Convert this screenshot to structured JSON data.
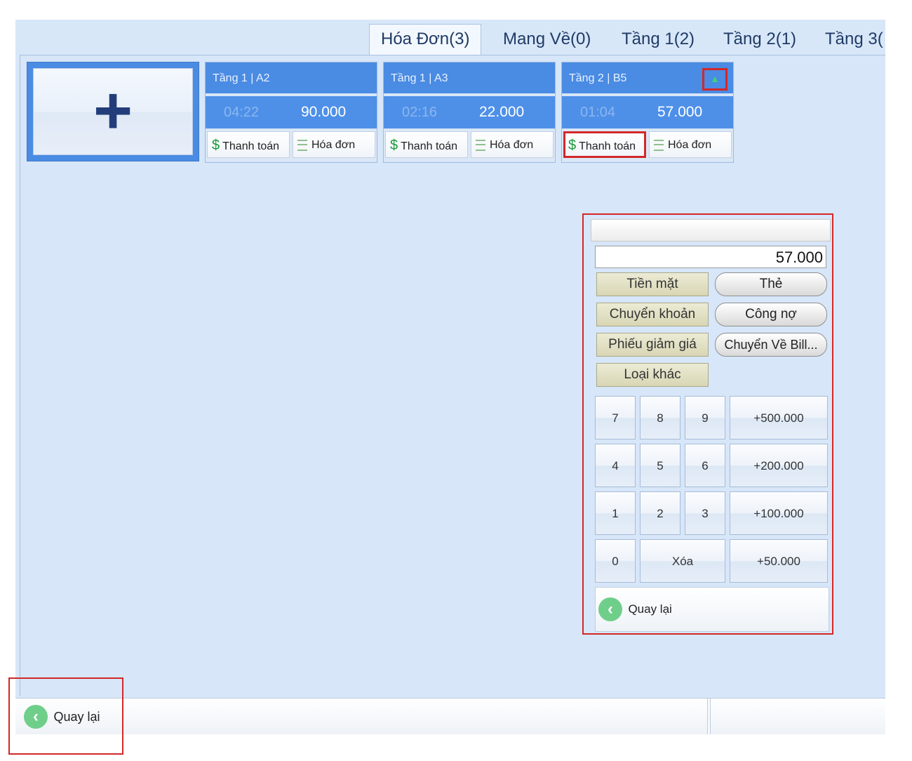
{
  "tabs": [
    "Hóa Đơn(3)",
    "Mang Về(0)",
    "Tầng 1(2)",
    "Tầng 2(1)",
    "Tầng 3("
  ],
  "add_card": {
    "icon": "plus-icon"
  },
  "tables": [
    {
      "name": "Tầng 1 | A2",
      "time": "04:22",
      "amount": "90.000",
      "pay_label": "Thanh toán",
      "invoice_label": "Hóa đơn"
    },
    {
      "name": "Tầng 1 | A3",
      "time": "02:16",
      "amount": "22.000",
      "pay_label": "Thanh toán",
      "invoice_label": "Hóa đơn"
    },
    {
      "name": "Tầng 2 | B5",
      "time": "01:04",
      "amount": "57.000",
      "pay_label": "Thanh toán",
      "invoice_label": "Hóa đơn",
      "bell": "bell-icon"
    }
  ],
  "payment": {
    "amount": "57.000",
    "methods_left": [
      "Tiền mặt",
      "Chuyển khoản",
      "Phiếu giảm giá",
      "Loại khác"
    ],
    "methods_right": [
      "Thẻ",
      "Công nợ",
      "Chuyển Về Bill..."
    ],
    "keys": {
      "k7": "7",
      "k8": "8",
      "k9": "9",
      "p500": "+500.000",
      "k4": "4",
      "k5": "5",
      "k6": "6",
      "p200": "+200.000",
      "k1": "1",
      "k2": "2",
      "k3": "3",
      "p100": "+100.000",
      "k0": "0",
      "clear": "Xóa",
      "p50": "+50.000"
    },
    "back_label": "Quay lại"
  },
  "bottom": {
    "back_label": "Quay lại"
  },
  "colors": {
    "accent": "#4a8be3",
    "highlight": "#d32828",
    "background": "#d8e7f8"
  }
}
